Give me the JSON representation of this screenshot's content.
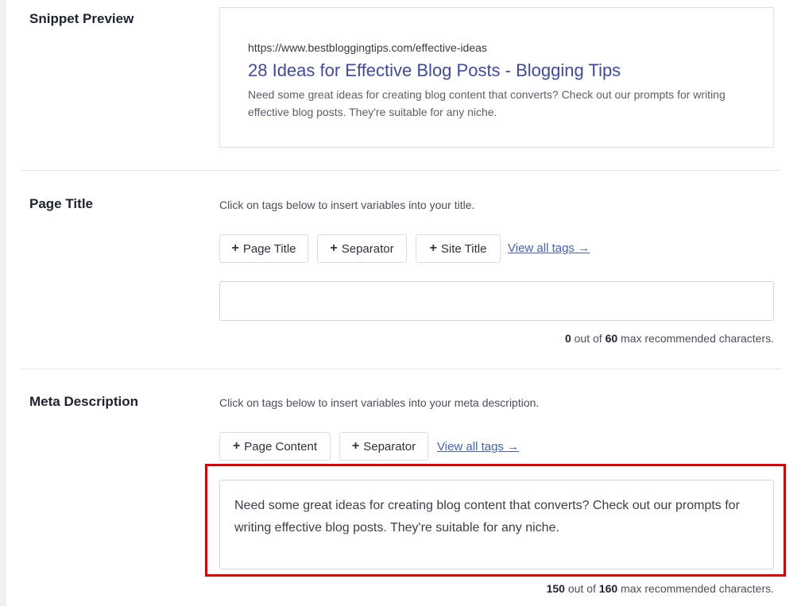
{
  "snippet_preview": {
    "label": "Snippet Preview",
    "url": "https://www.bestbloggingtips.com/effective-ideas",
    "title": "28 Ideas for Effective Blog Posts - Blogging Tips",
    "description": "Need some great ideas for creating blog content that converts? Check out our prompts for writing effective blog posts. They're suitable for any niche."
  },
  "page_title": {
    "label": "Page Title",
    "helper": "Click on tags below to insert variables into your title.",
    "tags": [
      {
        "label": "Page Title"
      },
      {
        "label": "Separator"
      },
      {
        "label": "Site Title"
      }
    ],
    "view_all": "View all tags",
    "arrow": "→",
    "value": "",
    "count_current": "0",
    "count_middle": " out of ",
    "count_max": "60",
    "count_suffix": " max recommended characters."
  },
  "meta_description": {
    "label": "Meta Description",
    "helper": "Click on tags below to insert variables into your meta description.",
    "tags": [
      {
        "label": "Page Content"
      },
      {
        "label": "Separator"
      }
    ],
    "view_all": "View all tags",
    "arrow": "→",
    "value": "Need some great ideas for creating blog content that converts? Check out our prompts for writing effective blog posts. They're suitable for any niche.",
    "count_current": "150",
    "count_middle": " out of ",
    "count_max": "160",
    "count_suffix": " max recommended characters."
  },
  "plus_glyph": "+",
  "colors": {
    "link": "#3f5fd0",
    "snippet_title": "#3e49a8",
    "highlight": "#e10000"
  }
}
